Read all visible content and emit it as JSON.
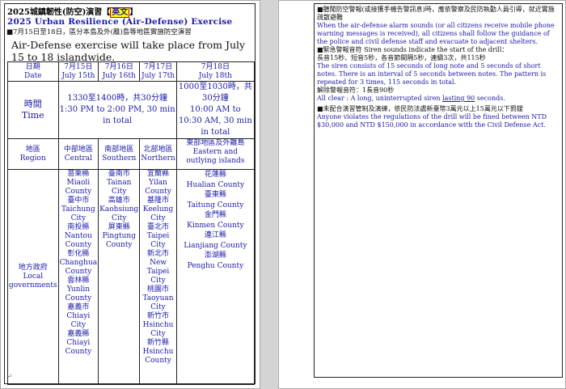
{
  "page1": {
    "title_cn": "2025城鎮韌性(防空)演習",
    "title_tag": "英文",
    "title_en": "2025 Urban Resilience (Air-Defense) Exercise",
    "intro_cn": "■7月15日至18日，區分本島及外(離)島等地區實施防空演習",
    "intro_en": "Air-Defense exercise will take place from July 15 to 18 islandwide.",
    "table": {
      "col_date_cn": "日期",
      "col_date_en": "Date",
      "dates": [
        {
          "cn": "7月15日",
          "en": "July 15th"
        },
        {
          "cn": "7月16日",
          "en": "July 16th"
        },
        {
          "cn": "7月17日",
          "en": "July 17th"
        },
        {
          "cn": "7月18日",
          "en": "July 18th"
        }
      ],
      "time_cn": "時間",
      "time_en": "Time",
      "time_a_cn": "1330至1400時，共30分鐘",
      "time_a_en": "1:30 PM to 2:00 PM, 30 min in total",
      "time_b_cn": "1000至1030時，共30分鐘",
      "time_b_en": "10:00 AM to 10:30 AM, 30 min in total",
      "region_cn": "地區",
      "region_en": "Region",
      "regions": [
        {
          "cn": "中部地區",
          "en": "Central"
        },
        {
          "cn": "南部地區",
          "en": "Southern"
        },
        {
          "cn": "北部地區",
          "en": "Northern"
        },
        {
          "cn": "東部地區及外離島",
          "en": "Eastern and outlying islands"
        }
      ],
      "gov_cn": "地方政府",
      "gov_en": "Local governments",
      "central": "苗栗縣\nMiaoli County\n臺中市\nTaichung City\n南投縣\nNantou County\n彰化縣\nChanghua County\n雲林縣\nYunlin County\n嘉義市\nChiayi City\n嘉義縣\nChiayi County",
      "southern": "臺南市\nTainan City\n高雄市\nKaohsiung City\n屏東縣\nPingtung County",
      "northern": "宜蘭縣\nYilan County\n基隆市\nKeelung City\n臺北市\nTaipei City\n新北市\nNew Taipei City\n桃園市\nTaoyuan City\n新竹市\nHsinchu City\n新竹縣\nHsinchu County",
      "eastern": "花蓮縣\nHualian County\n臺東縣\nTaitung County\n金門縣\nKinmen County\n連江縣\nLianjiang County\n澎湖縣\nPenghu County"
    }
  },
  "page2": {
    "p1_cn": "■聽聞防空警報(或接獲手機告警訊息)時，應依警察及民防執勤人員引導，就近實施疏散避難",
    "p1_en": "When the air-defense alarm sounds (or all citizens receive mobile phone warning messages is received), all citizens shall follow the guidance of the police and civil defense staff and evacuate to adjacent shelters.",
    "p2_cn": "■緊急警報音符 Siren sounds indicate the start of the drill：",
    "p2_cn2": "長音15秒、短音5秒，各音節間隔5秒，連續3次，共115秒",
    "p2_en": "The siren consists of 15 seconds of long note and 5 seconds of short notes. There is an interval of 5 seconds between notes. The pattern is repeated for 3 times, 115 seconds in total.",
    "p3_cn": "解除警報音符：1長音90秒",
    "p3_en_a": "All clear : A long, uninterrupted siren ",
    "p3_en_u": "lasting  90",
    "p3_en_b": " seconds.",
    "p4_cn": "■未配合演習管制及演練，依民防法處新臺幣3萬元以上15萬元以下罰鍰",
    "p4_en": "Anyone violates the regulations of the drill will be fined between NTD $30,000 and NTD $150,000 in accordance with the Civil Defense Act."
  }
}
